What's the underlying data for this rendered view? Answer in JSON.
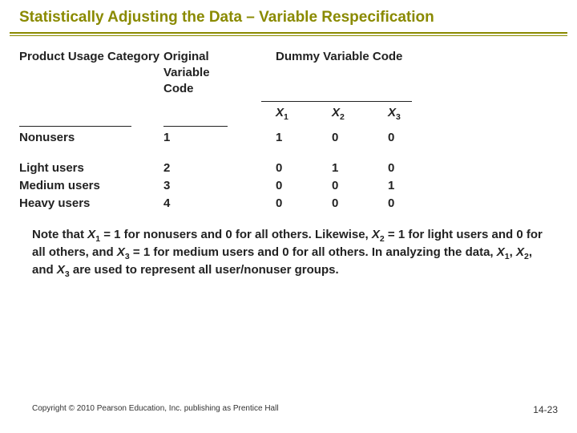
{
  "title": "Statistically Adjusting the Data – Variable Respecification",
  "headers": {
    "product": "Product Usage Category",
    "original": "Original Variable Code",
    "dummy": "Dummy  Variable  Code",
    "x1": "X",
    "x1_sub": "1",
    "x2": "X",
    "x2_sub": "2",
    "x3": "X",
    "x3_sub": "3"
  },
  "rows": {
    "r0": {
      "label": "Nonusers",
      "orig": "1",
      "d1": "1",
      "d2": "0",
      "d3": "0"
    },
    "r1": {
      "label": "Light users",
      "orig": "2",
      "d1": "0",
      "d2": "1",
      "d3": "0"
    },
    "r2": {
      "label": "Medium users",
      "orig": "3",
      "d1": "0",
      "d2": "0",
      "d3": "1"
    },
    "r3": {
      "label": "Heavy users",
      "orig": "4",
      "d1": "0",
      "d2": "0",
      "d3": "0"
    }
  },
  "note": {
    "p1a": "Note that ",
    "p1b": " = 1 for nonusers and 0 for all others.  Likewise, ",
    "p1c": " = 1 for light users and 0 for all others, and ",
    "p1d": " = 1 for medium users and 0 for all others.  In analyzing the data, ",
    "p1e": ", ",
    "p1f": ", and ",
    "p1g": " are used to represent all user/nonuser groups."
  },
  "footer": {
    "copyright": "Copyright © 2010 Pearson Education, Inc. publishing as Prentice Hall",
    "page": "14-23"
  }
}
